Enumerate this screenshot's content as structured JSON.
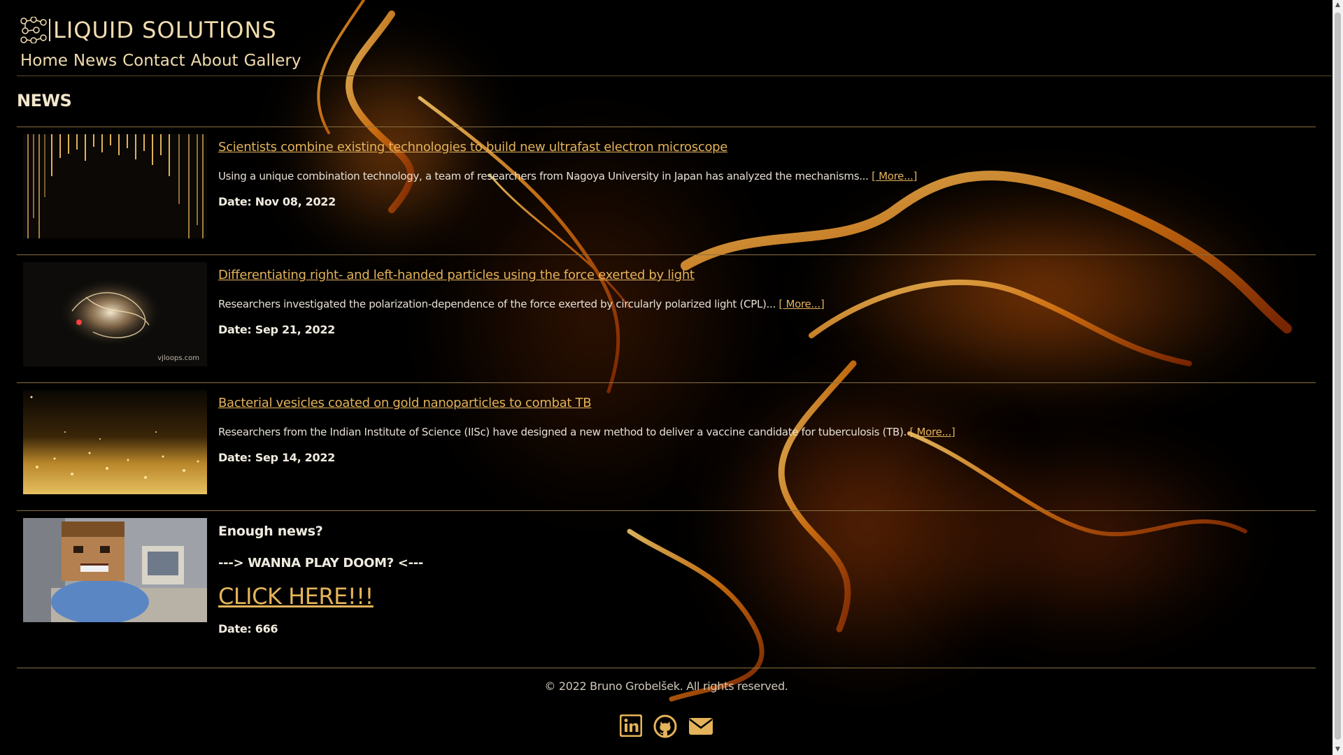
{
  "site": {
    "logo_text": "LIQUID SOLUTIONS",
    "accent_color": "#e4b35a",
    "text_color": "#f1dcae"
  },
  "nav": {
    "items": [
      {
        "label": "Home"
      },
      {
        "label": "News"
      },
      {
        "label": "Contact"
      },
      {
        "label": "About"
      },
      {
        "label": "Gallery"
      }
    ]
  },
  "main": {
    "section_title": "NEWS",
    "news": [
      {
        "title": "Scientists combine existing technologies to build new ultrafast electron microscope",
        "summary": "Using a unique combination technology, a team of researchers from Nagoya University in Japan has analyzed the mechanisms...",
        "more_label": "[ More...]",
        "date": "Date: Nov 08, 2022",
        "thumbnail": "golden-rain-image"
      },
      {
        "title": "Differentiating right- and left-handed particles using the force exerted by light",
        "summary": "Researchers investigated the polarization-dependence of the force exerted by circularly polarized light (CPL)...",
        "more_label": "[ More...]",
        "date": "Date: Sep 21, 2022",
        "thumbnail": "light-particles-image",
        "thumbnail_watermark": "vjloops.com"
      },
      {
        "title": "Bacterial vesicles coated on gold nanoparticles to combat TB",
        "summary": "Researchers from the Indian Institute of Science (IISc) have designed a new method to deliver a vaccine candidate for tuberculosis (TB).",
        "more_label": "[ More...]",
        "date": "Date: Sep 14, 2022",
        "thumbnail": "gold-glitter-image"
      }
    ],
    "doom": {
      "question": "Enough news?",
      "wanna": "---> WANNA PLAY DOOM? <---",
      "click_label": "CLICK HERE!!!",
      "date": "Date: 666",
      "thumbnail": "doom-guy-office-image"
    }
  },
  "footer": {
    "copyright": "© 2022 Bruno Grobelšek. All rights reserved.",
    "social_icons": [
      "linkedin-icon",
      "github-icon",
      "email-icon"
    ]
  }
}
